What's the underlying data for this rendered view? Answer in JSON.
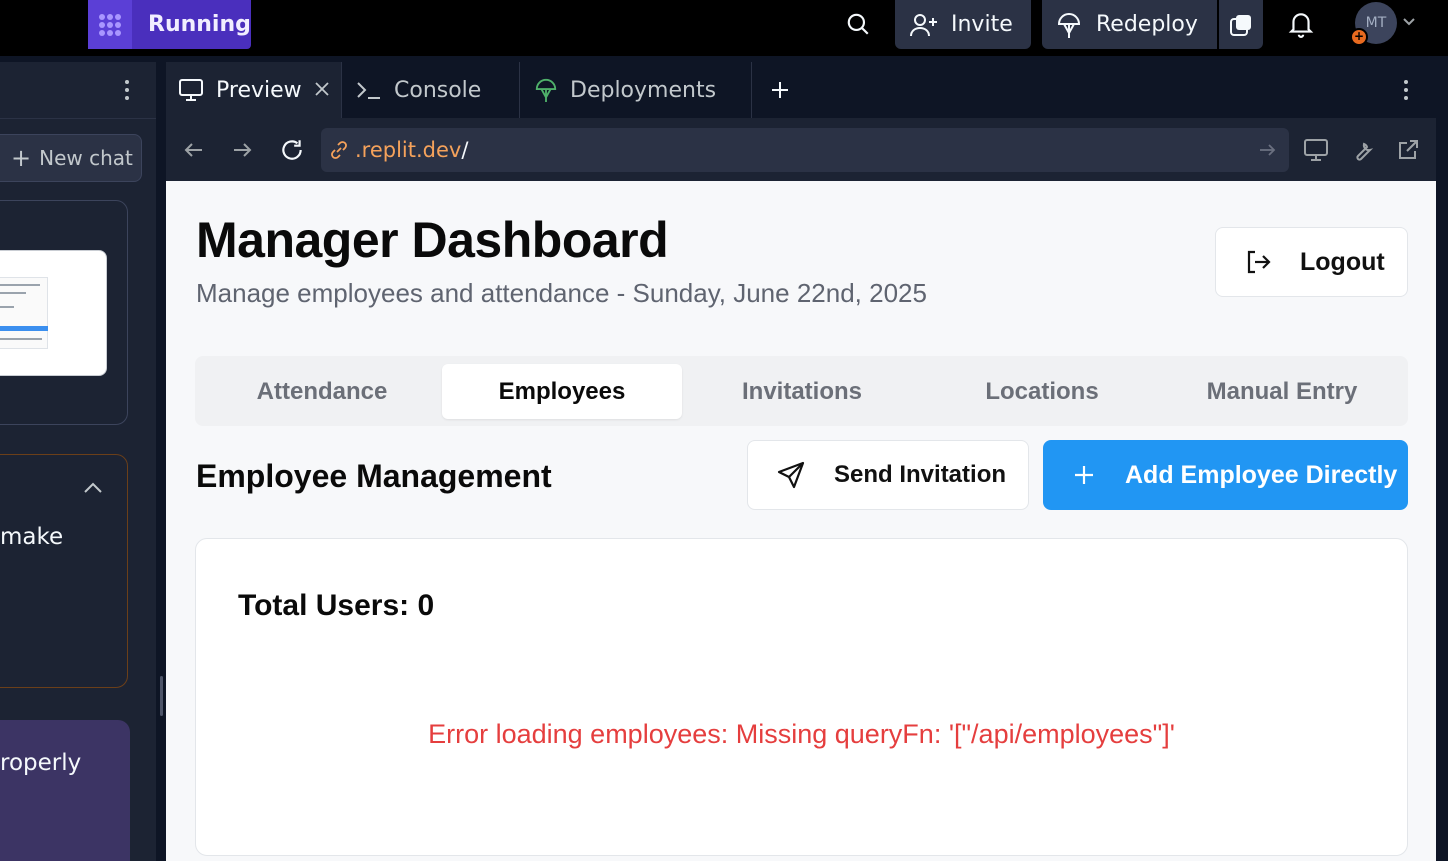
{
  "topbar": {
    "status_label": "Running",
    "invite_label": "Invite",
    "redeploy_label": "Redeploy",
    "avatar_initials": "MT"
  },
  "left_panel": {
    "new_chat_label": "New chat",
    "card_text_1": "make",
    "card_text_2": "roperly"
  },
  "workspace_tabs": [
    {
      "label": "Preview",
      "icon": "monitor-icon",
      "active": true
    },
    {
      "label": "Console",
      "icon": "terminal-icon",
      "active": false
    },
    {
      "label": "Deployments",
      "icon": "deploy-icon",
      "active": false
    }
  ],
  "url": {
    "host": ".replit.dev",
    "path": "/"
  },
  "app": {
    "title": "Manager Dashboard",
    "subtitle": "Manage employees and attendance - Sunday, June 22nd, 2025",
    "logout_label": "Logout",
    "tabs": [
      "Attendance",
      "Employees",
      "Invitations",
      "Locations",
      "Manual Entry"
    ],
    "selected_tab": "Employees",
    "section_title": "Employee Management",
    "send_invitation_label": "Send Invitation",
    "add_employee_label": "Add Employee Directly",
    "total_users_label": "Total Users: 0",
    "error_message": "Error loading employees: Missing queryFn: '[\"/api/employees\"]'"
  },
  "colors": {
    "accent_blue": "#2196f3",
    "error_red": "#e53e3e",
    "running_purple": "#4a2fbd"
  }
}
